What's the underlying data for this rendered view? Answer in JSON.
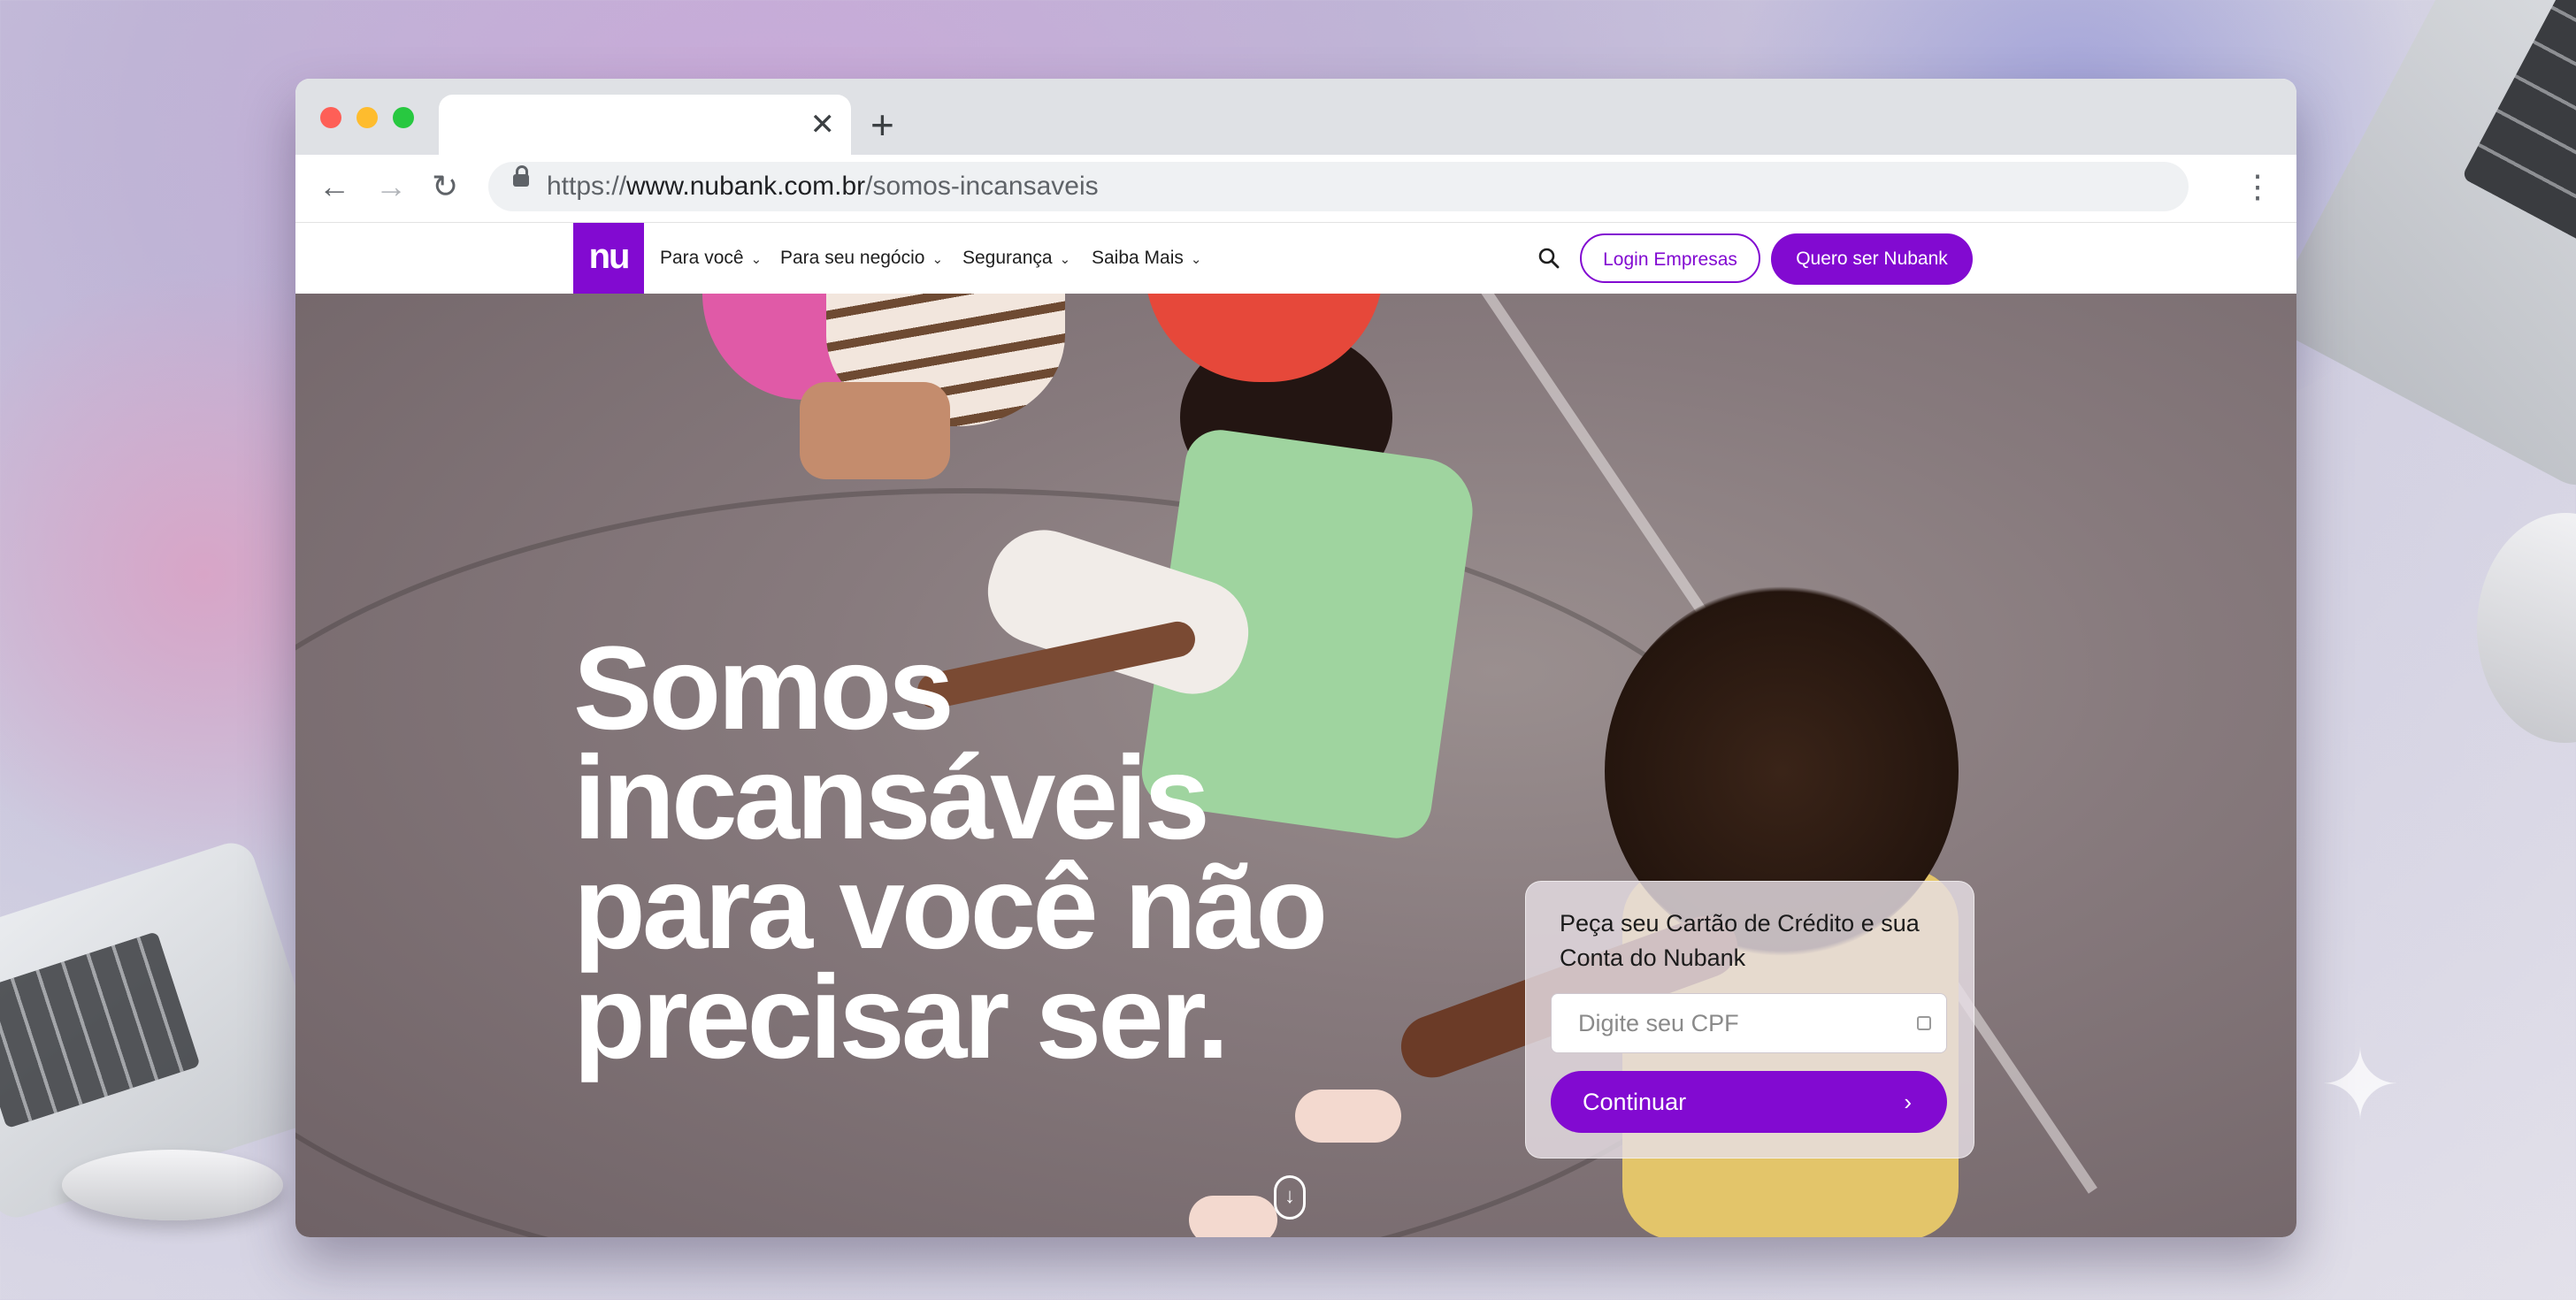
{
  "browser": {
    "tab": {
      "close_symbol": "✕"
    },
    "new_tab_symbol": "+",
    "toolbar": {
      "back_symbol": "←",
      "forward_symbol": "→",
      "reload_symbol": "↻",
      "menu_symbol": "⋮"
    },
    "url": {
      "scheme": "https://",
      "host": "www.nubank.com.br",
      "path": "/somos-incansaveis"
    }
  },
  "site": {
    "logo_text": "nu",
    "brand_color": "#820ad1",
    "nav": {
      "items": [
        {
          "label": "Para você"
        },
        {
          "label": "Para seu negócio"
        },
        {
          "label": "Segurança"
        },
        {
          "label": "Saiba Mais"
        }
      ],
      "chevron_symbol": "⌄",
      "login_label": "Login Empresas",
      "cta_label": "Quero ser Nubank"
    },
    "hero": {
      "headline_lines": [
        "Somos",
        "incansáveis",
        "para você não",
        "precisar ser."
      ],
      "card": {
        "title": "Peça seu Cartão de Crédito e sua Conta do Nubank",
        "cpf_placeholder": "Digite seu CPF",
        "cpf_value": "",
        "continue_label": "Continuar",
        "continue_arrow": "›"
      },
      "scroll_symbol": "↓"
    }
  }
}
